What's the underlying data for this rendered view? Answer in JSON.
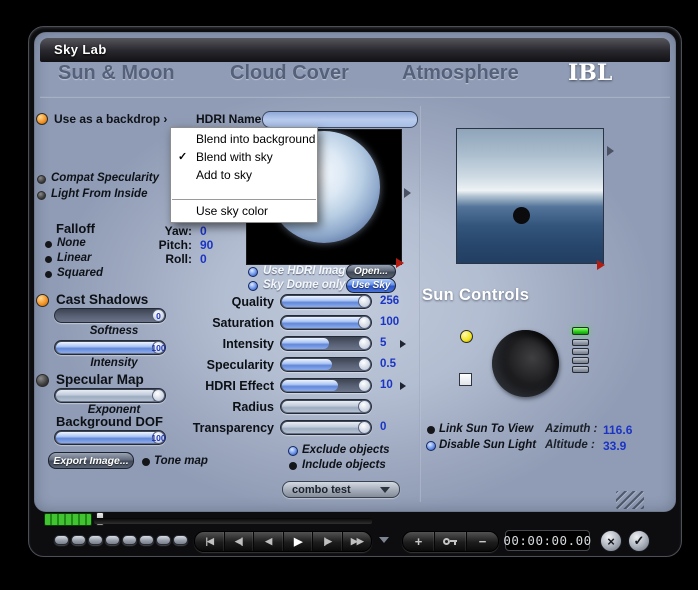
{
  "colors": {
    "accent_blue": "#2a54c8",
    "value_blue": "#1b34c4",
    "led_orange": "#f29020",
    "led_yellow": "#f2e41f",
    "led_green": "#2fd01e",
    "panel": "#aab5c9"
  },
  "window": {
    "title": "Sky Lab"
  },
  "tabs": [
    "Sun & Moon",
    "Cloud Cover",
    "Atmosphere",
    "IBL"
  ],
  "backdrop": {
    "label": "Use as a backdrop ›",
    "hdri_label": "HDRI Name",
    "hdri_value": ""
  },
  "menu": {
    "items": [
      "Blend into background",
      "Blend with sky",
      "Add to sky",
      "Use sky color"
    ],
    "checked_item": "Blend with sky",
    "check_glyph": "✓"
  },
  "left": {
    "compat": "Compat Specularity",
    "light_inside": "Light From Inside",
    "falloff": {
      "title": "Falloff",
      "options": [
        "None",
        "Linear",
        "Squared"
      ]
    },
    "rotation": [
      {
        "label": "Yaw:",
        "value": "0"
      },
      {
        "label": "Pitch:",
        "value": "90"
      },
      {
        "label": "Roll:",
        "value": "0"
      }
    ],
    "use_hdri": {
      "label": "Use HDRI Image",
      "button": "Open..."
    },
    "sky_dome": {
      "label": "Sky Dome only",
      "button": "Use Sky"
    },
    "cast_shadows": {
      "title": "Cast Shadows",
      "softness": {
        "label": "Softness",
        "value": "0"
      },
      "intensity": {
        "label": "Intensity",
        "value": "100"
      }
    },
    "specular_map": {
      "title": "Specular Map",
      "exponent": {
        "label": "Exponent",
        "value": ""
      }
    },
    "background_dof": {
      "title": "Background DOF",
      "value": "100"
    },
    "export_button": "Export Image...",
    "tone_map": "Tone map"
  },
  "center": {
    "sliders": [
      {
        "label": "Quality",
        "value": "256"
      },
      {
        "label": "Saturation",
        "value": "100"
      },
      {
        "label": "Intensity",
        "value": "5"
      },
      {
        "label": "Specularity",
        "value": "0.5"
      },
      {
        "label": "HDRI Effect",
        "value": "10"
      },
      {
        "label": "Radius",
        "value": ""
      },
      {
        "label": "Transparency",
        "value": "0"
      }
    ],
    "objects": {
      "exclude": "Exclude objects",
      "include": "Include objects"
    },
    "combo": "combo test"
  },
  "sun": {
    "title": "Sun Controls",
    "link": "Link Sun To View",
    "disable": "Disable Sun Light",
    "azimuth_label": "Azimuth :",
    "azimuth_value": "116.6",
    "altitude_label": "Altitude :",
    "altitude_value": "33.9"
  },
  "transport": {
    "buttons": [
      "|◀",
      "◀|",
      "◀",
      "▶",
      "|▶",
      "▶▶"
    ],
    "plus": "+",
    "minus": "−",
    "time": "00:00:00.00",
    "cancel": "×",
    "confirm": "✓"
  }
}
